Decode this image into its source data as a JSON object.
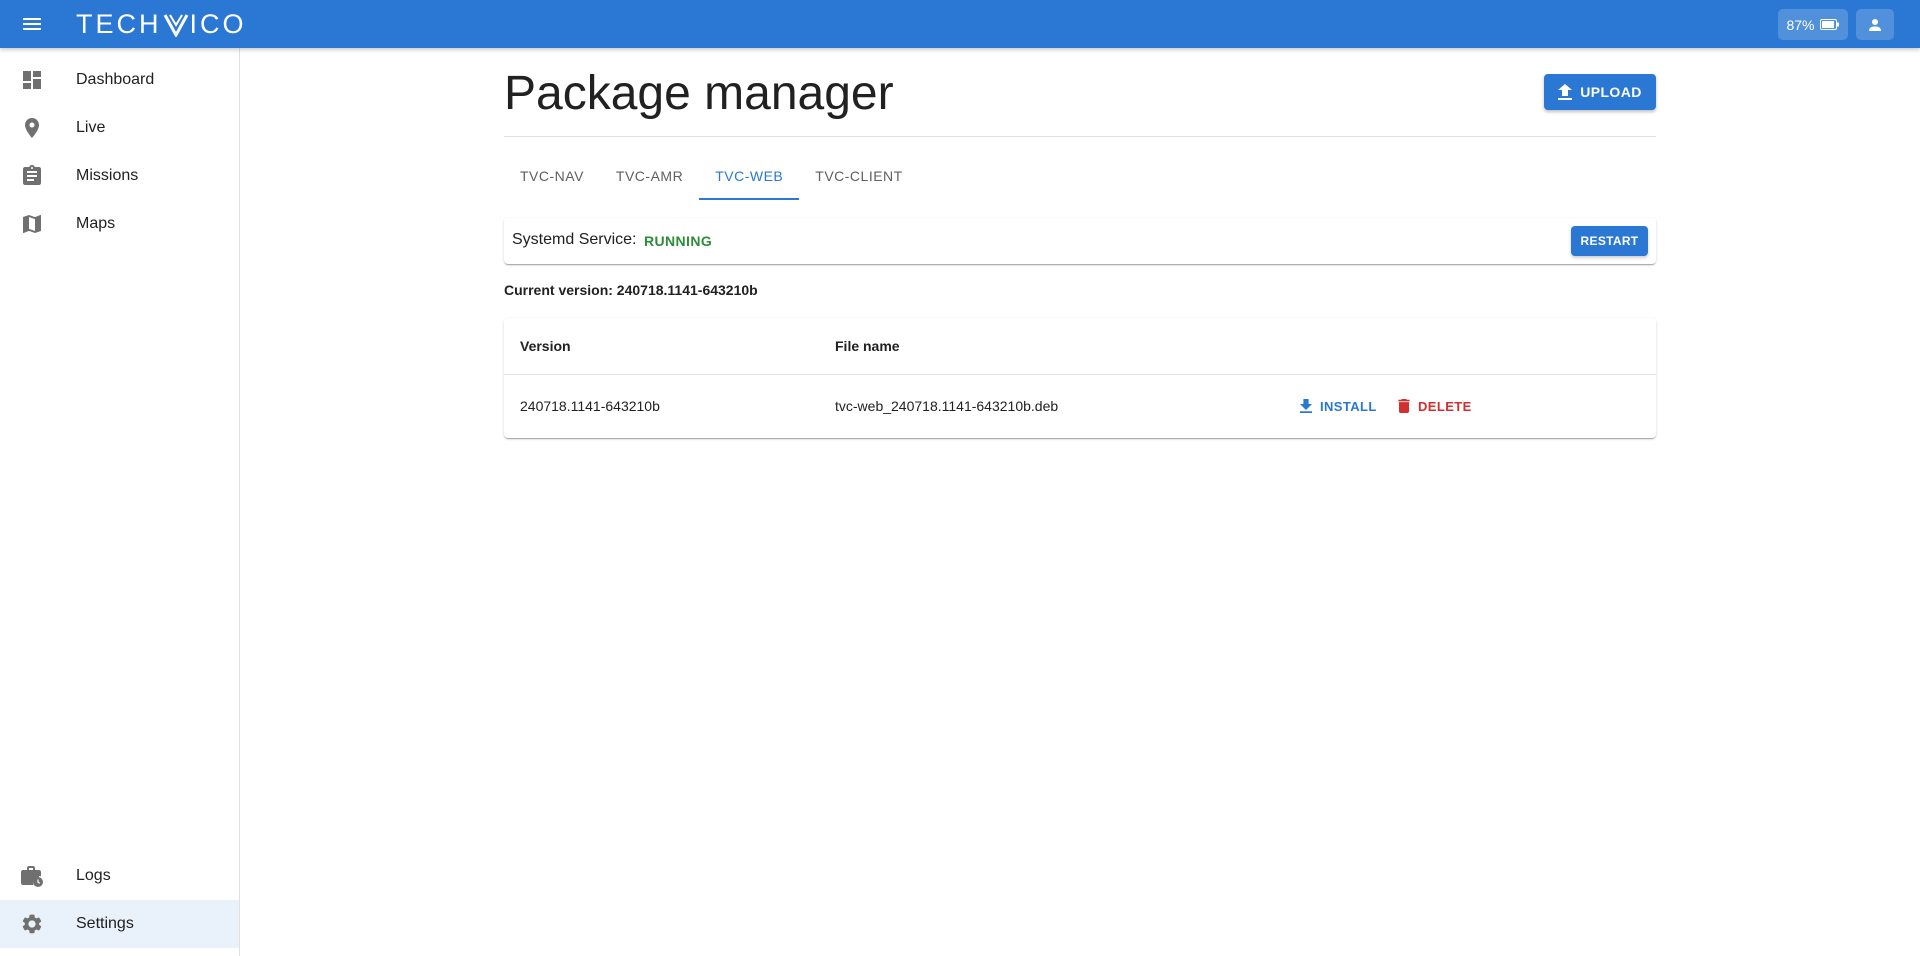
{
  "appbar": {
    "logo_left": "TECH",
    "logo_right": "ICO",
    "battery_text": "87%"
  },
  "sidebar": {
    "items": [
      {
        "label": "Dashboard",
        "icon": "dashboard-icon"
      },
      {
        "label": "Live",
        "icon": "location-pin-icon"
      },
      {
        "label": "Missions",
        "icon": "clipboard-icon"
      },
      {
        "label": "Maps",
        "icon": "map-icon"
      }
    ],
    "bottom_items": [
      {
        "label": "Logs",
        "icon": "work-history-icon"
      },
      {
        "label": "Settings",
        "icon": "gear-icon",
        "active": true
      }
    ]
  },
  "main": {
    "title": "Package manager",
    "upload_label": "UPLOAD",
    "tabs": [
      {
        "label": "TVC-NAV"
      },
      {
        "label": "TVC-AMR"
      },
      {
        "label": "TVC-WEB",
        "active": true
      },
      {
        "label": "TVC-CLIENT"
      }
    ],
    "service": {
      "label": "Systemd Service:",
      "status": "RUNNING",
      "restart_label": "RESTART"
    },
    "current_version": "Current version: 240718.1141-643210b",
    "table": {
      "headers": [
        "Version",
        "File name"
      ],
      "rows": [
        {
          "version": "240718.1141-643210b",
          "file_name": "tvc-web_240718.1141-643210b.deb",
          "install_label": "INSTALL",
          "delete_label": "DELETE"
        }
      ]
    }
  },
  "colors": {
    "primary": "#2b78d4",
    "running": "#2e8b3a",
    "danger": "#d32f2f"
  }
}
